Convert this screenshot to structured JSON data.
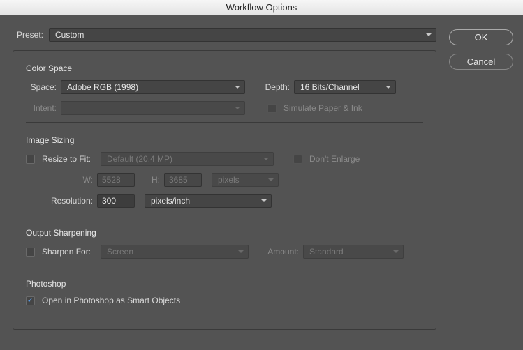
{
  "window": {
    "title": "Workflow Options"
  },
  "buttons": {
    "ok": "OK",
    "cancel": "Cancel"
  },
  "preset": {
    "label": "Preset:",
    "value": "Custom"
  },
  "colorSpace": {
    "title": "Color Space",
    "spaceLabel": "Space:",
    "space": "Adobe RGB (1998)",
    "depthLabel": "Depth:",
    "depth": "16 Bits/Channel",
    "intentLabel": "Intent:",
    "intent": "",
    "simulateLabel": "Simulate Paper & Ink"
  },
  "imageSizing": {
    "title": "Image Sizing",
    "resizeLabel": "Resize to Fit:",
    "resizeValue": "Default  (20.4 MP)",
    "dontEnlarge": "Don't Enlarge",
    "wLabel": "W:",
    "w": "5528",
    "hLabel": "H:",
    "h": "3685",
    "unit": "pixels",
    "resolutionLabel": "Resolution:",
    "resolution": "300",
    "resUnit": "pixels/inch"
  },
  "sharpen": {
    "title": "Output Sharpening",
    "forLabel": "Sharpen For:",
    "for": "Screen",
    "amountLabel": "Amount:",
    "amount": "Standard"
  },
  "photoshop": {
    "title": "Photoshop",
    "smartObjects": "Open in Photoshop as Smart Objects"
  }
}
